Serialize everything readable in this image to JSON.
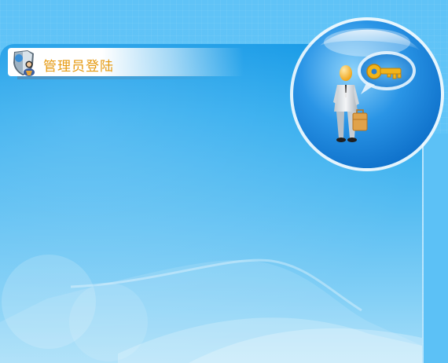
{
  "header": {
    "title": "管理员登陆",
    "badge_icon": "admin-shield-icon"
  },
  "hero": {
    "figure_icon": "businessman-icon",
    "key_icon": "key-icon",
    "bubble_icon": "speech-bubble-icon"
  },
  "colors": {
    "panel_top": "#0f97e6",
    "panel_bottom": "#a6def9",
    "background": "#5fc3f7",
    "title": "#e69a12",
    "key_gold": "#f2b41a"
  }
}
